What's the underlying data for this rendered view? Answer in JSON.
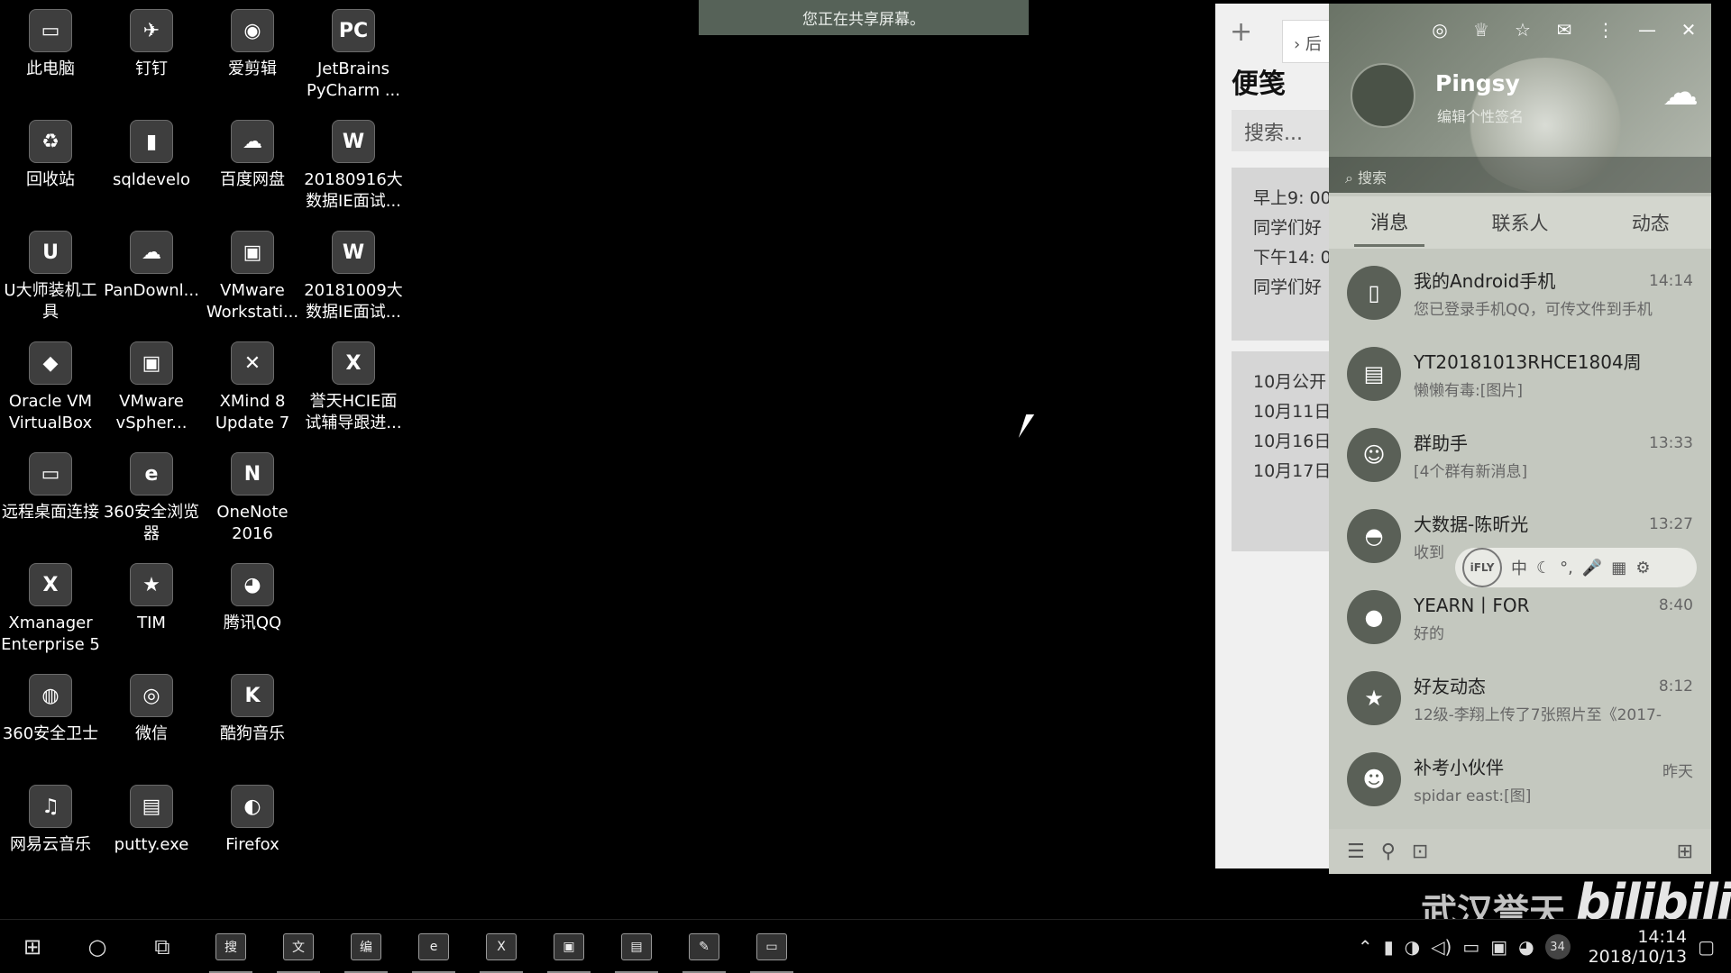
{
  "share_banner": "您正在共享屏幕。",
  "desktop_icons": [
    {
      "label": "此电脑",
      "glyph": "▭"
    },
    {
      "label": "钉钉",
      "glyph": "✈"
    },
    {
      "label": "爱剪辑",
      "glyph": "◉"
    },
    {
      "label": "JetBrains\nPyCharm ...",
      "glyph": "PC"
    },
    {
      "label": "回收站",
      "glyph": "♻"
    },
    {
      "label": "sqldevelo",
      "glyph": "▮"
    },
    {
      "label": "百度网盘",
      "glyph": "☁"
    },
    {
      "label": "20180916大\n数据IE面试...",
      "glyph": "W"
    },
    {
      "label": "U大师装机工\n具",
      "glyph": "U"
    },
    {
      "label": "PanDownl...",
      "glyph": "☁"
    },
    {
      "label": "VMware\nWorkstati...",
      "glyph": "▣"
    },
    {
      "label": "20181009大\n数据IE面试...",
      "glyph": "W"
    },
    {
      "label": "Oracle VM\nVirtualBox",
      "glyph": "◆"
    },
    {
      "label": "VMware\nvSpher...",
      "glyph": "▣"
    },
    {
      "label": "XMind 8\nUpdate 7",
      "glyph": "✕"
    },
    {
      "label": "誉天HCIE面\n试辅导跟进...",
      "glyph": "X"
    },
    {
      "label": "远程桌面连接",
      "glyph": "▭"
    },
    {
      "label": "360安全浏览\n器",
      "glyph": "e"
    },
    {
      "label": "OneNote\n2016",
      "glyph": "N"
    },
    {
      "label": "Xmanager\nEnterprise 5",
      "glyph": "X"
    },
    {
      "label": "TIM",
      "glyph": "★"
    },
    {
      "label": "腾讯QQ",
      "glyph": "◕"
    },
    {
      "label": "360安全卫士",
      "glyph": "◍"
    },
    {
      "label": "微信",
      "glyph": "◎"
    },
    {
      "label": "酷狗音乐",
      "glyph": "K"
    },
    {
      "label": "网易云音乐",
      "glyph": "♫"
    },
    {
      "label": "putty.exe",
      "glyph": "▤"
    },
    {
      "label": "Firefox",
      "glyph": "◐"
    }
  ],
  "notes": {
    "plus": "+",
    "nav_label": "›  后",
    "title": "便笺",
    "search_placeholder": "搜索...",
    "card1": [
      "早上9: 00",
      "同学们好",
      "下午14: 0",
      "同学们好"
    ],
    "card2": [
      "10月公开",
      "",
      "10月11日",
      "10月16日",
      "10月17日"
    ]
  },
  "qq": {
    "username": "Pingsy",
    "signature": "编辑个性签名",
    "search_placeholder": "搜索",
    "tabs": [
      "消息",
      "联系人",
      "动态"
    ],
    "conversations": [
      {
        "name": "我的Android手机",
        "message": "您已登录手机QQ，可传文件到手机",
        "time": "14:14",
        "glyph": "▯"
      },
      {
        "name": "YT20181013RHCE1804周",
        "message": "懒懒有毒:[图片]",
        "time": "",
        "glyph": "▤"
      },
      {
        "name": "群助手",
        "message": "[4个群有新消息]",
        "time": "13:33",
        "glyph": "☺"
      },
      {
        "name": "大数据-陈昕光",
        "message": "收到",
        "time": "13:27",
        "glyph": "◓"
      },
      {
        "name": "YEARN丨FOR",
        "message": "好的",
        "time": "8:40",
        "glyph": "●"
      },
      {
        "name": "好友动态",
        "message": "12级-李翔上传了7张照片至《2017-",
        "time": "8:12",
        "glyph": "★"
      },
      {
        "name": "补考小伙伴",
        "message": "spidar east:[图]",
        "time": "昨天",
        "glyph": "☻"
      }
    ],
    "ifly_logo": "iFLY",
    "ifly_tools": [
      "中",
      "☾",
      "°,",
      "🎤",
      "▦",
      "⚙"
    ]
  },
  "watermark": "武汉誉天",
  "bili_logo": "bilibili",
  "taskbar": {
    "apps": [
      "搜",
      "文",
      "编",
      "e",
      "X",
      "▣",
      "▤",
      "✎",
      "▭"
    ],
    "tray_badge": "34",
    "time": "14:14",
    "date": "2018/10/13"
  }
}
